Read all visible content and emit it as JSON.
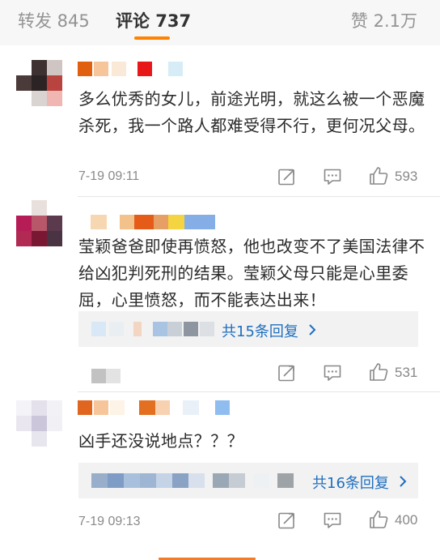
{
  "tabs": {
    "repost": "转发 845",
    "comments": "评论 737",
    "likes": "赞 2.1万"
  },
  "comments": [
    {
      "text": "多么优秀的女儿，前途光明，就这么被一个恶魔杀死，我一个路人都难受得不行，更何况父母。",
      "time": "7-19 09:11",
      "likes": "593"
    },
    {
      "text": "莹颖爸爸即使再愤怒，他也改变不了美国法律不给凶犯判死刑的结果。莹颖父母只能是心里委屈，心里愤怒，而不能表达出来！",
      "reply_link": "共15条回复",
      "time": "",
      "likes": "531"
    },
    {
      "text": "凶手还没说地点？？？",
      "reply_link": "共16条回复",
      "time": "7-19 09:13",
      "likes": "400"
    }
  ],
  "icons": {
    "repost": "repost-icon",
    "comment": "comment-icon",
    "like": "thumbs-up-icon",
    "reply_chevron": "chevron-right-icon"
  },
  "colors": {
    "accent": "#ff8200",
    "link": "#1e6ebf",
    "tab_bg": "#f7f7f7",
    "reply_bg": "#f2f2f2"
  }
}
